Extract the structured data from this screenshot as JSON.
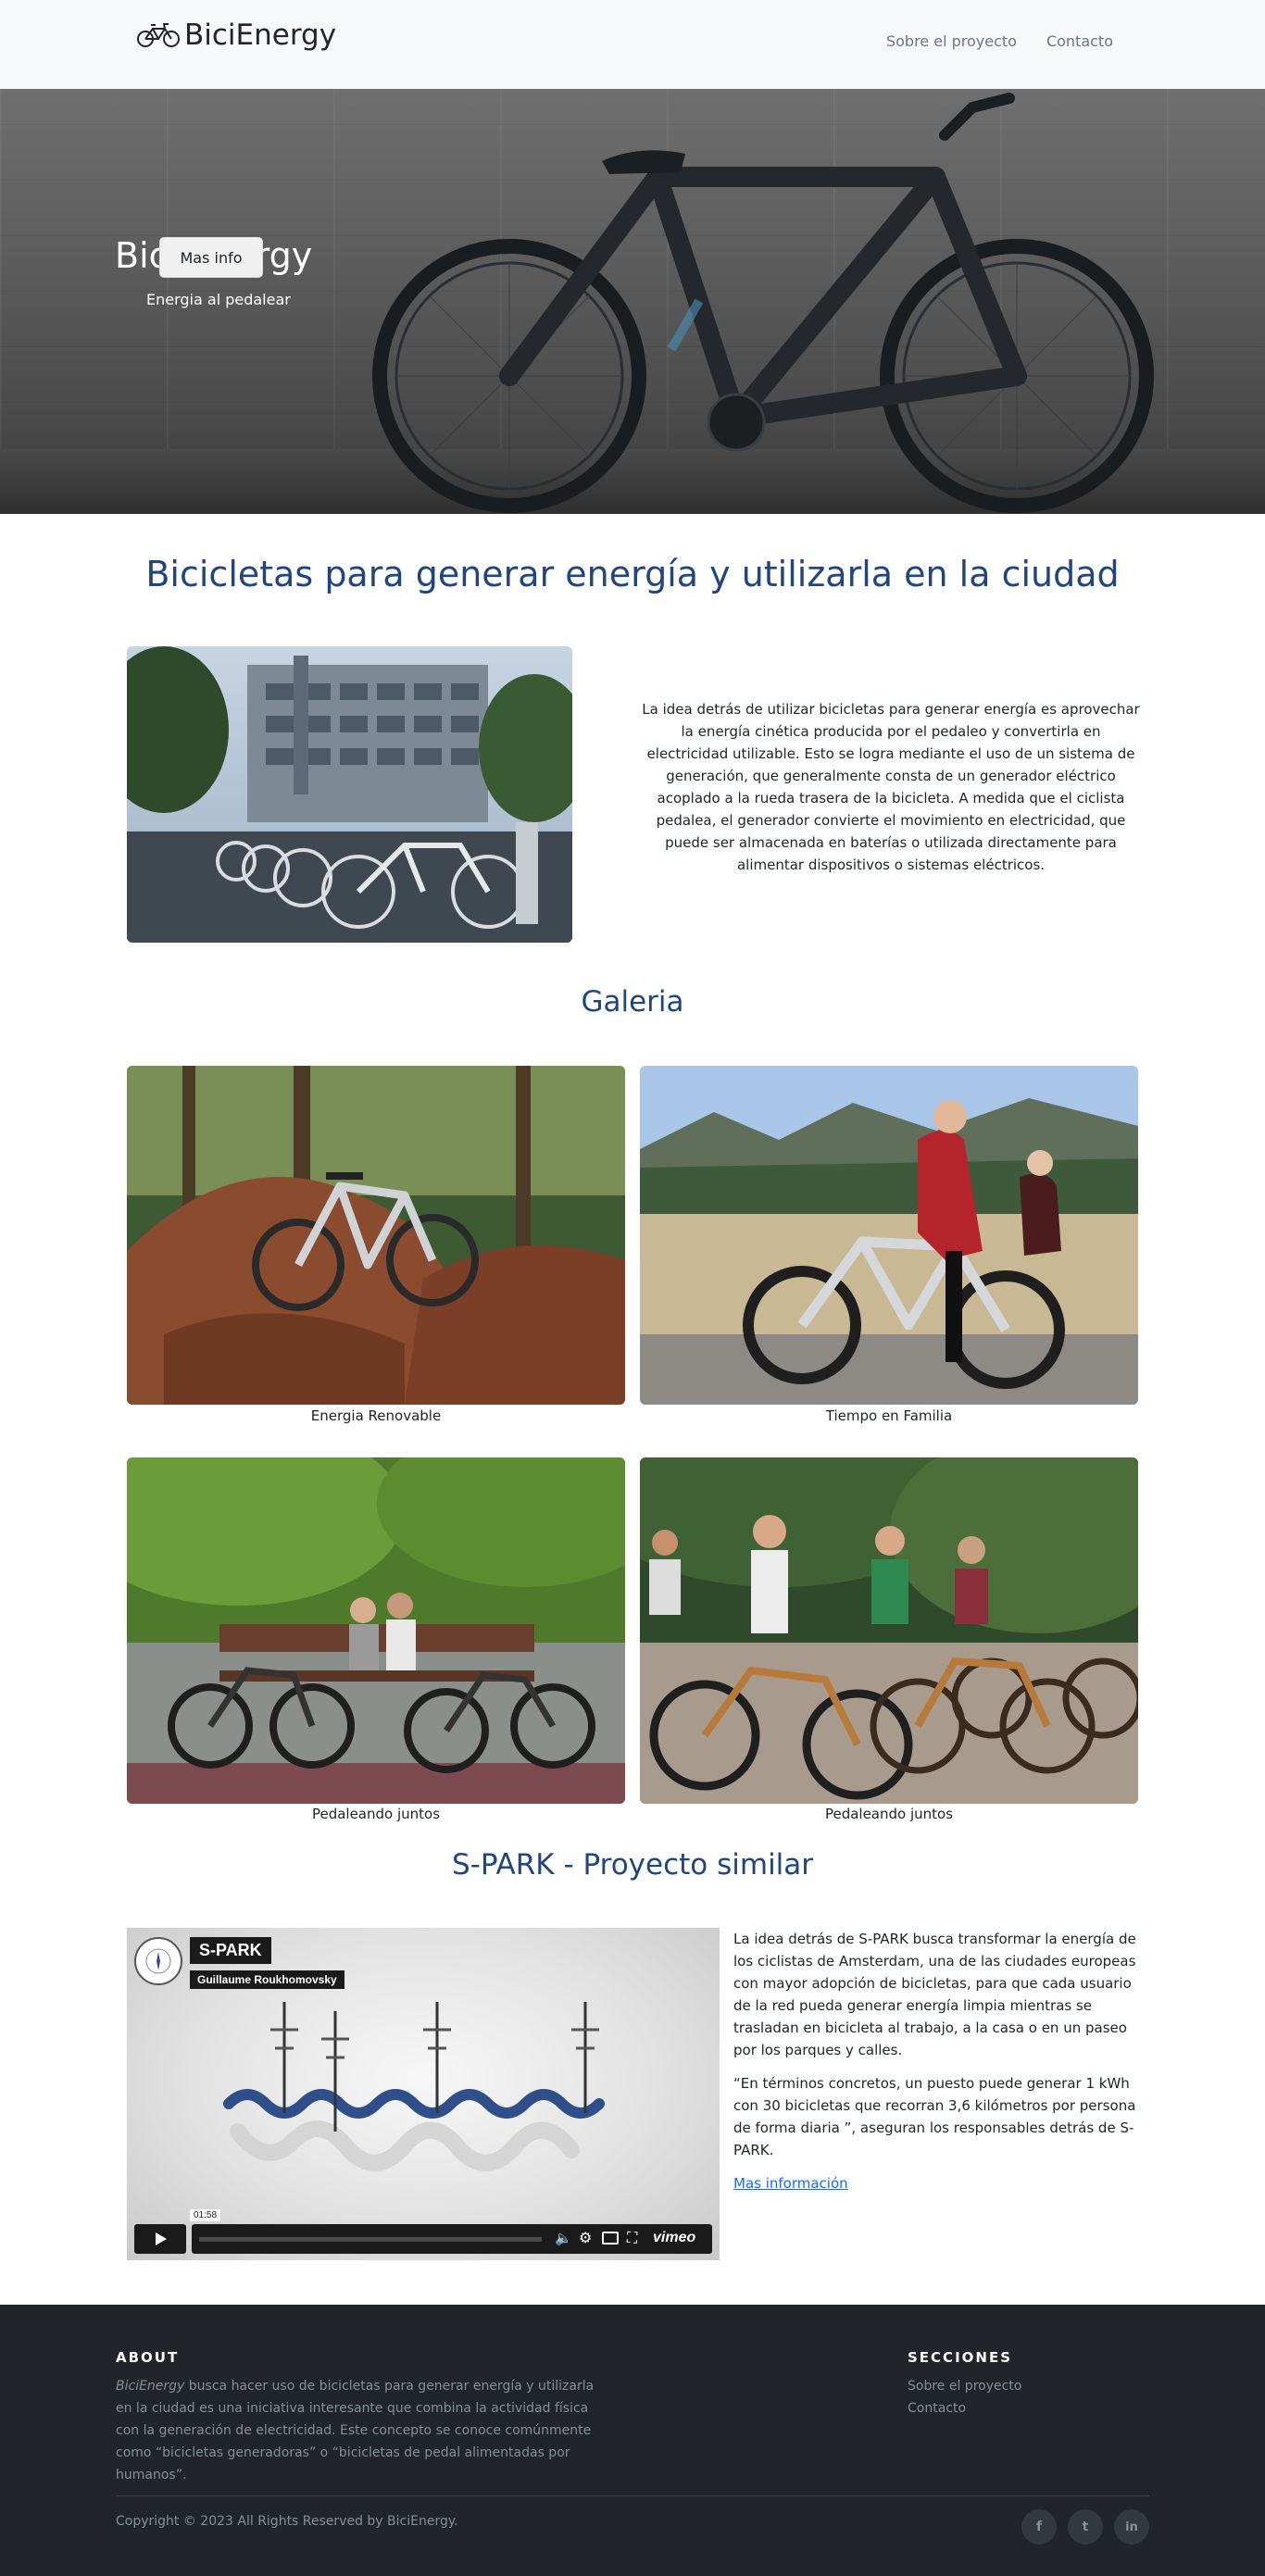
{
  "nav": {
    "brand": "BiciEnergy",
    "links": [
      "Sobre el proyecto",
      "Contacto"
    ]
  },
  "hero": {
    "title": "Bici Energy",
    "subtitle": "Energia al pedalear",
    "button": "Mas info"
  },
  "main": {
    "heading": "Bicicletas para generar energía y utilizarla en la ciudad",
    "intro": "La idea detrás de utilizar bicicletas para generar energía es aprovechar la energía cinética producida por el pedaleo y convertirla en electricidad utilizable. Esto se logra mediante el uso de un sistema de generación, que generalmente consta de un generador eléctrico acoplado a la rueda trasera de la bicicleta. A medida que el ciclista pedalea, el generador convierte el movimiento en electricidad, que puede ser almacenada en baterías o utilizada directamente para alimentar dispositivos o sistemas eléctricos."
  },
  "gallery": {
    "heading": "Galeria",
    "items": [
      {
        "caption": "Energia Renovable"
      },
      {
        "caption": "Tiempo en Familia"
      },
      {
        "caption": "Pedaleando juntos"
      },
      {
        "caption": "Pedaleando juntos"
      }
    ]
  },
  "spark": {
    "heading": "S-PARK - Proyecto similar",
    "video": {
      "title": "S-PARK",
      "author": "Guillaume Roukhomovsky",
      "time": "01:58",
      "brand": "vimeo"
    },
    "p1": "La idea detrás de S-PARK busca transformar la energía de los ciclistas de Amsterdam, una de las ciudades europeas con mayor adopción de bicicletas, para que cada usuario de la red pueda generar energía limpia mientras se trasladan en bicicleta al trabajo, a la casa o en un paseo por los parques y calles.",
    "p2": "“En términos concretos, un puesto puede generar 1 kWh con 30 bicicletas que recorran 3,6 kilómetros por persona de forma diaria ”, aseguran los responsables detrás de S-PARK.",
    "link": "Mas información"
  },
  "footer": {
    "about_heading": "ABOUT",
    "about_brand": "BiciEnergy",
    "about_text": " busca hacer uso de bicicletas para generar energía y utilizarla en la ciudad es una iniciativa interesante que combina la actividad física con la generación de electricidad. Este concepto se conoce comúnmente como “bicicletas generadoras” o “bicicletas de pedal alimentadas por humanos”.",
    "sections_heading": "SECCIONES",
    "sections": [
      "Sobre el proyecto",
      "Contacto"
    ],
    "copyright": "Copyright © 2023 All Rights Reserved by BiciEnergy.",
    "social": [
      "f",
      "t",
      "in"
    ]
  }
}
